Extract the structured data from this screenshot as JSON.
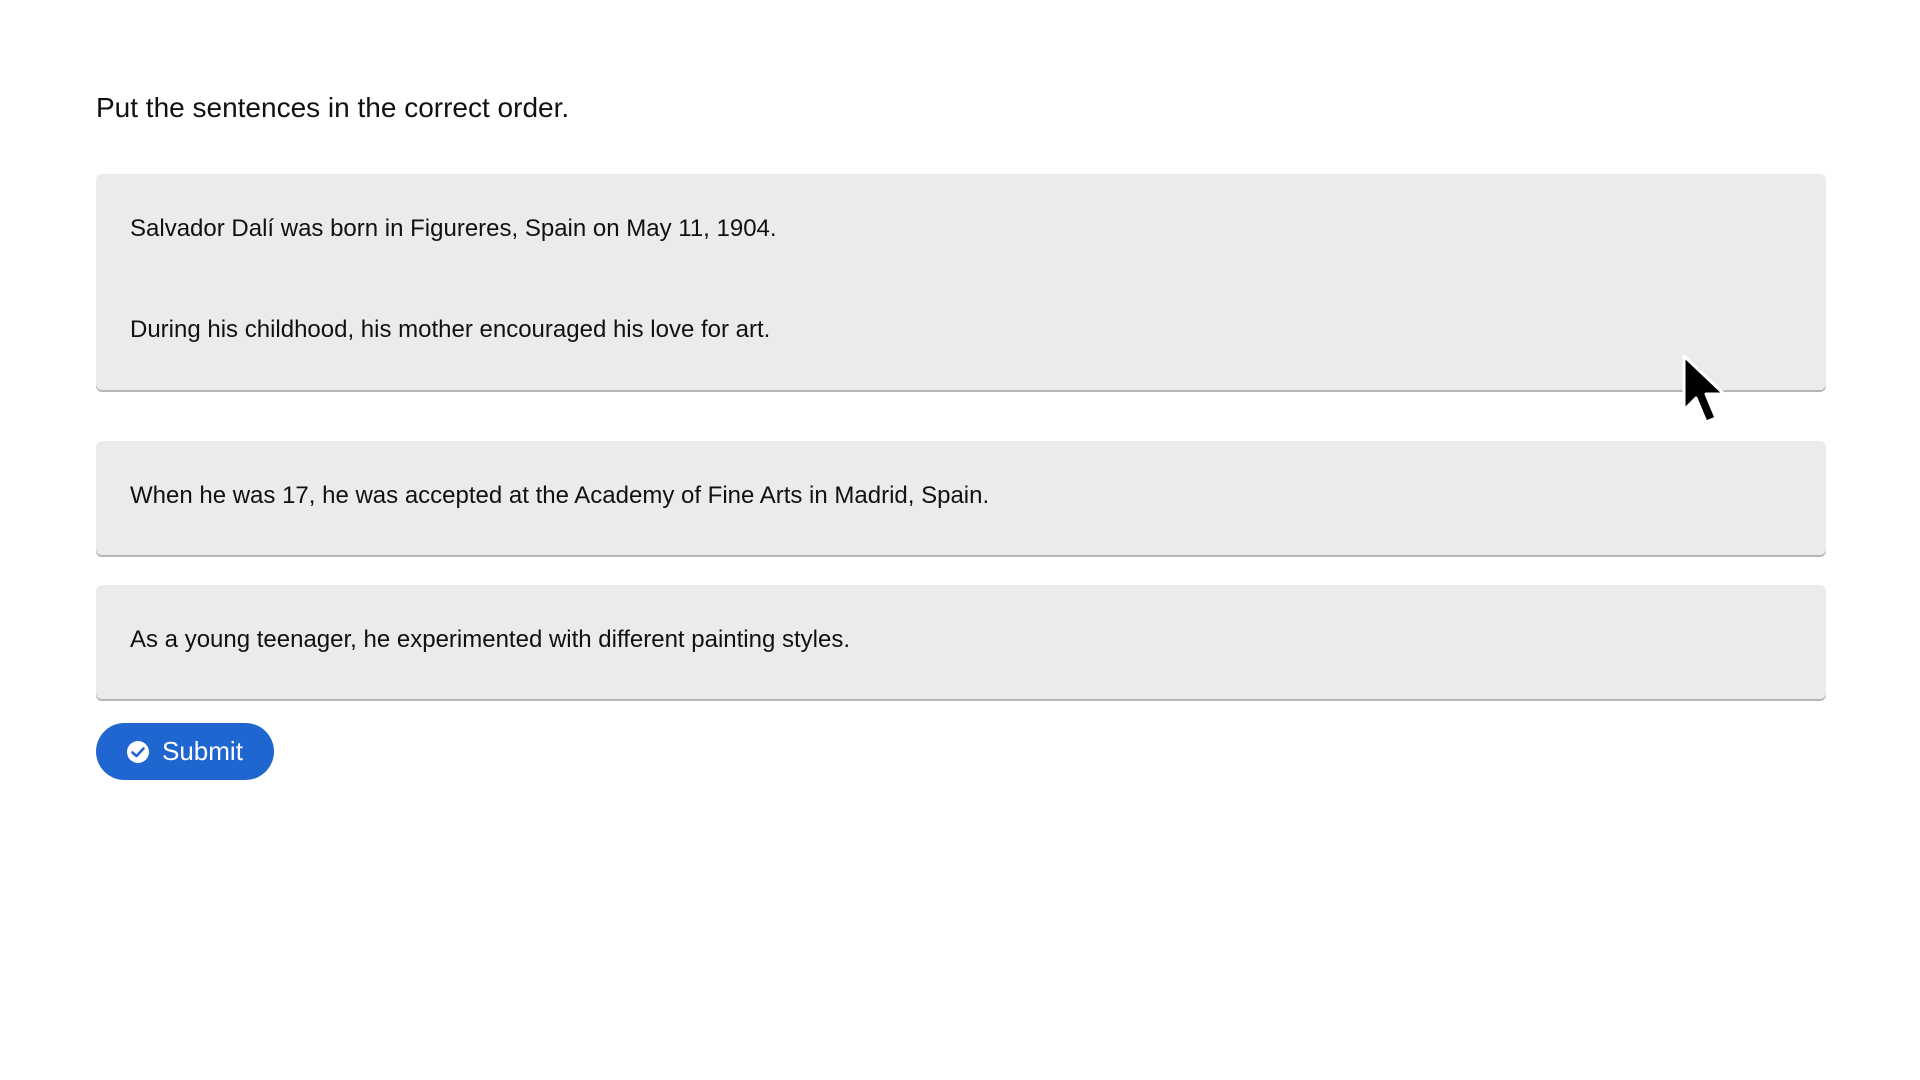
{
  "instruction": "Put the sentences in the correct order.",
  "sentences": [
    {
      "text": "Salvador Dalí was born in Figureres, Spain on May 11, 1904."
    },
    {
      "text": "During his childhood, his mother encouraged his love for art."
    },
    {
      "text": "When he was 17, he was accepted at the Academy of Fine Arts in Madrid, Spain."
    },
    {
      "text": "As a young teenager, he experimented with different painting styles."
    }
  ],
  "submit": {
    "label": "Submit",
    "icon": "check-circle-icon",
    "color": "#1f66d1"
  },
  "colors": {
    "card_background": "#ebebeb",
    "text": "#111111"
  }
}
